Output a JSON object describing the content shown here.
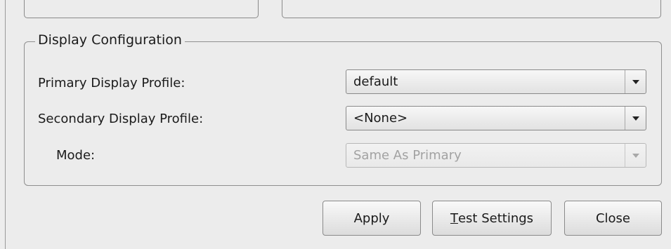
{
  "display_config": {
    "group_title": "Display Configuration",
    "primary": {
      "label": "Primary Display Profile:",
      "value": "default"
    },
    "secondary": {
      "label": "Secondary Display Profile:",
      "value": "<None>"
    },
    "mode": {
      "label": "Mode:",
      "value": "Same As Primary",
      "enabled": false
    }
  },
  "buttons": {
    "apply": "Apply",
    "test_mnemonic": "T",
    "test_rest": "est Settings",
    "close": "Close"
  }
}
